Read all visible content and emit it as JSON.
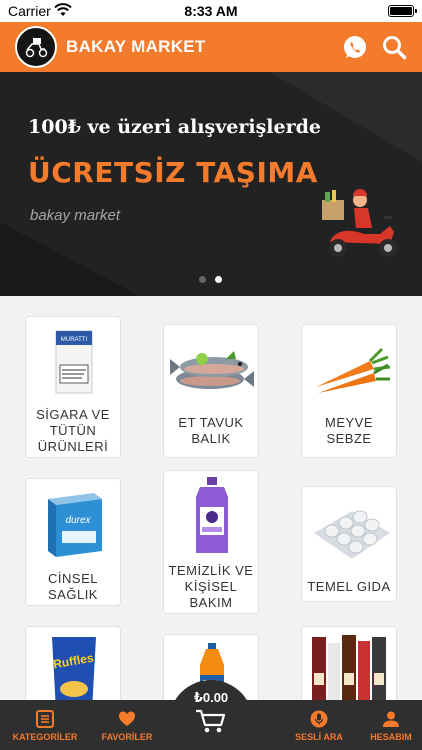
{
  "status_bar": {
    "carrier": "Carrier",
    "time": "8:33 AM"
  },
  "header": {
    "title": "BAKAY MARKET",
    "brand_color": "#f47a2c",
    "icons": [
      "logo-icon",
      "whatsapp-icon",
      "search-icon"
    ]
  },
  "banner": {
    "line1": "100₺ ve üzeri alışverişlerde",
    "line2": "ÜCRETSİZ TAŞIMA",
    "line3": "bakay market",
    "pager": {
      "count": 2,
      "active_index": 2
    }
  },
  "categories": [
    {
      "label": "SİGARA VE TÜTÜN ÜRÜNLERİ",
      "icon": "cigarette-pack-icon"
    },
    {
      "label": "ET TAVUK BALIK",
      "icon": "fish-icon"
    },
    {
      "label": "MEYVE SEBZE",
      "icon": "carrot-icon"
    },
    {
      "label": "CİNSEL SAĞLIK",
      "icon": "condom-box-icon"
    },
    {
      "label": "TEMİZLİK VE KİŞİSEL BAKIM",
      "icon": "detergent-bottle-icon"
    },
    {
      "label": "TEMEL GIDA",
      "icon": "egg-tray-icon"
    },
    {
      "label": "",
      "icon": "chips-bag-icon"
    },
    {
      "label": "",
      "icon": "soda-bottle-icon"
    },
    {
      "label": "",
      "icon": "liquor-bottles-icon"
    }
  ],
  "bottom_nav": {
    "tabs": [
      {
        "label": "KATEGORİLER",
        "icon": "list-icon"
      },
      {
        "label": "FAVORİLER",
        "icon": "heart-icon"
      },
      {
        "label": "SESLİ ARA",
        "icon": "microphone-icon"
      },
      {
        "label": "HESABIM",
        "icon": "user-icon"
      }
    ],
    "cart_total": "₺0.00",
    "cart_icon": "cart-icon"
  }
}
